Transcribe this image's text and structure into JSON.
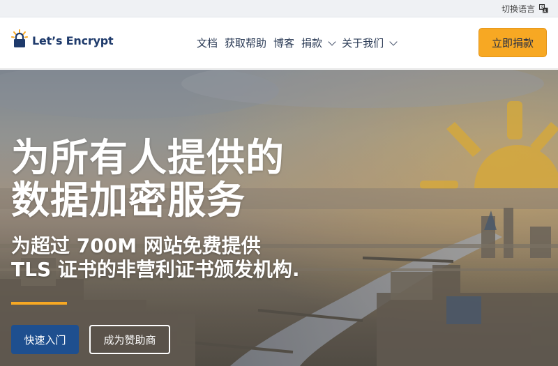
{
  "topbar": {
    "lang_label": "切换语言",
    "lang_icon": "translate-icon"
  },
  "nav": {
    "logo_text": "Let’s Encrypt",
    "logo_icon": "padlock-sun-icon",
    "menu": [
      {
        "label": "文档",
        "has_dropdown": false
      },
      {
        "label": "获取帮助",
        "has_dropdown": false
      },
      {
        "label": "博客",
        "has_dropdown": false
      },
      {
        "label": "捐款",
        "has_dropdown": true
      },
      {
        "label": "关于我们",
        "has_dropdown": true
      }
    ],
    "donate_label": "立即捐款"
  },
  "hero": {
    "title_line1": "为所有人提供的",
    "title_line2": "数据加密服务",
    "subtitle_line1": "为超过 700M 网站免费提供",
    "subtitle_line2": "TLS 证书的非营利证书颁发机构.",
    "primary_button": "快速入门",
    "secondary_button": "成为赞助商"
  },
  "colors": {
    "accent": "#f7a823",
    "brand_blue": "#1e3a6b",
    "primary_button": "#1e4f8f"
  }
}
